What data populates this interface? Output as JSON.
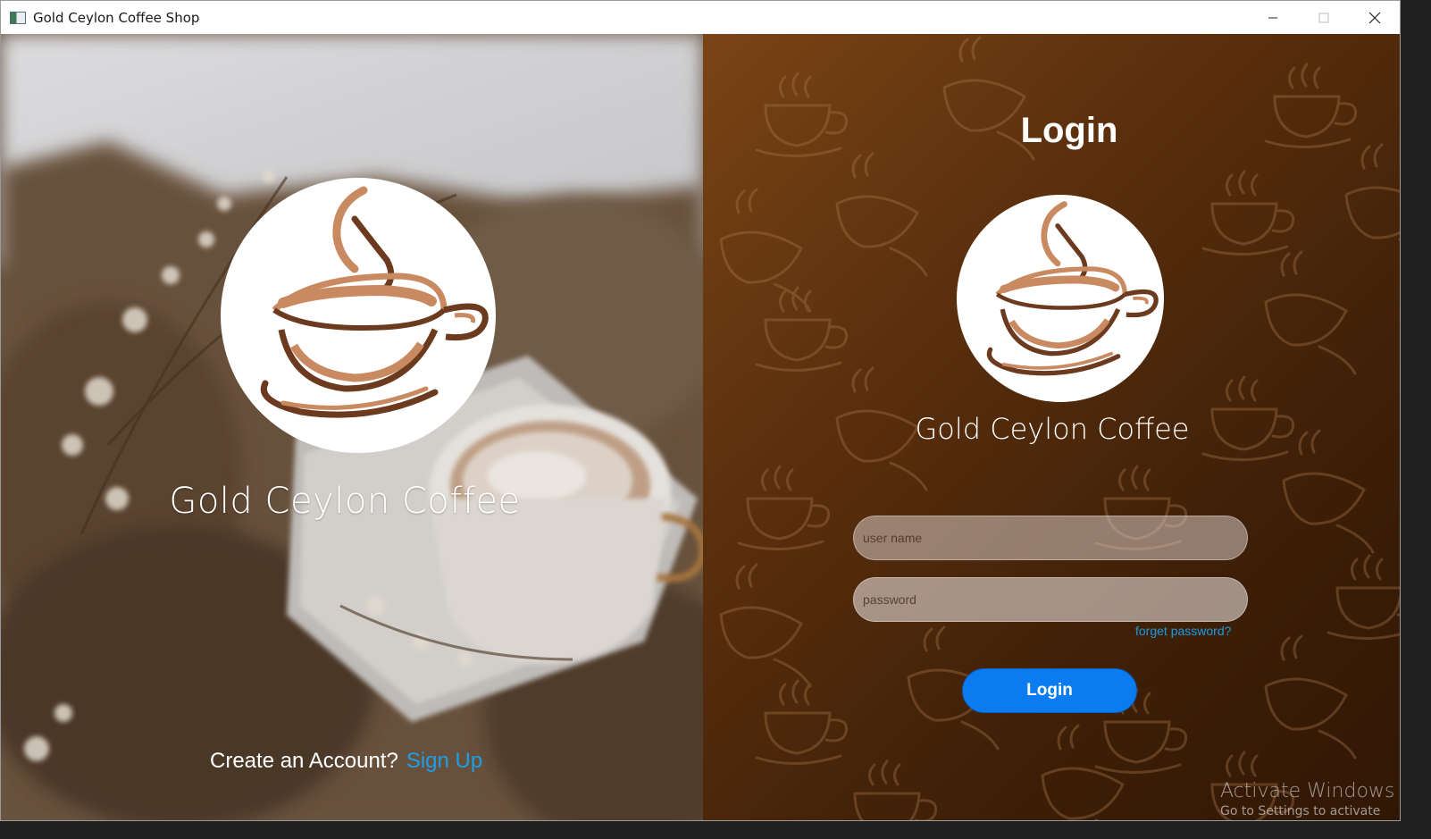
{
  "window": {
    "title": "Gold Ceylon Coffee Shop",
    "controls": [
      "minimize-icon",
      "maximize-icon",
      "close-icon"
    ]
  },
  "left": {
    "brand_name": "Gold Ceylon Coffee",
    "create_prompt": "Create an Account?",
    "signup_label": "Sign Up"
  },
  "right": {
    "heading": "Login",
    "brand_name": "Gold Ceylon Coffee",
    "username_placeholder": "user name",
    "password_placeholder": "password",
    "forget_label": "forget password?",
    "login_button_label": "Login"
  },
  "watermark": {
    "title": "Activate Windows",
    "subtitle": "Go to Settings to activate"
  },
  "colors": {
    "accent_blue": "#0a7cf0",
    "link_blue": "#1aa0e8",
    "panel_brown": "#5a2f0d",
    "logo_dark": "#6b3a1f",
    "logo_light": "#c98a62"
  }
}
